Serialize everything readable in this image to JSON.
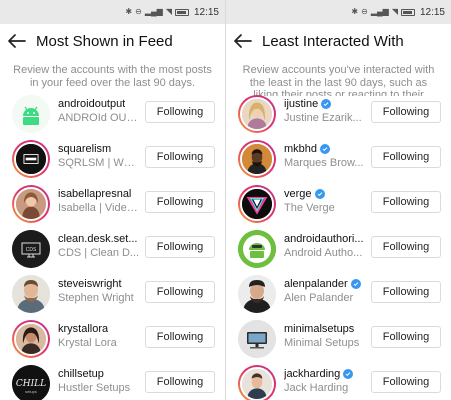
{
  "status_bar": {
    "time": "12:15"
  },
  "left": {
    "title": "Most Shown in Feed",
    "description": "Review the accounts with the most posts in your feed over the last 90 days.",
    "accounts": [
      {
        "username": "androidoutput",
        "fullname": "ANDROId OUT...",
        "verified": false,
        "button": "Following",
        "avatar": "android-logo-avatar"
      },
      {
        "username": "squarelism",
        "fullname": "SQRLSM | WO...",
        "verified": false,
        "button": "Following",
        "avatar": "squarelism-avatar"
      },
      {
        "username": "isabellapresnal",
        "fullname": "Isabella | Video...",
        "verified": false,
        "button": "Following",
        "avatar": "person-avatar"
      },
      {
        "username": "clean.desk.set...",
        "fullname": "CDS | Clean D...",
        "verified": false,
        "button": "Following",
        "avatar": "cds-avatar"
      },
      {
        "username": "steveiswright",
        "fullname": "Stephen Wright",
        "verified": false,
        "button": "Following",
        "avatar": "person-avatar"
      },
      {
        "username": "krystallora",
        "fullname": "Krystal Lora",
        "verified": false,
        "button": "Following",
        "avatar": "person-avatar"
      },
      {
        "username": "chillsetup",
        "fullname": "Hustler Setups",
        "verified": false,
        "button": "Following",
        "avatar": "chill-avatar"
      }
    ]
  },
  "right": {
    "title": "Least Interacted With",
    "description": "Review accounts you've interacted with the least in the last 90 days, such as liking their posts or reacting to their",
    "accounts": [
      {
        "username": "ijustine",
        "fullname": "Justine Ezarik...",
        "verified": true,
        "button": "Following",
        "avatar": "person-avatar"
      },
      {
        "username": "mkbhd",
        "fullname": "Marques Brow...",
        "verified": true,
        "button": "Following",
        "avatar": "person-avatar"
      },
      {
        "username": "verge",
        "fullname": "The Verge",
        "verified": true,
        "button": "Following",
        "avatar": "verge-logo-avatar"
      },
      {
        "username": "androidauthori...",
        "fullname": "Android Autho...",
        "verified": false,
        "button": "Following",
        "avatar": "android-authority-avatar"
      },
      {
        "username": "alenpalander",
        "fullname": "Alen Palander",
        "verified": true,
        "button": "Following",
        "avatar": "person-avatar"
      },
      {
        "username": "minimalsetups",
        "fullname": "Minimal Setups",
        "verified": false,
        "button": "Following",
        "avatar": "minimal-setups-avatar"
      },
      {
        "username": "jackharding",
        "fullname": "Jack Harding",
        "verified": true,
        "button": "Following",
        "avatar": "person-avatar"
      }
    ]
  },
  "colors": {
    "ring_start": "#f7a234",
    "ring_end": "#c13584",
    "verified_blue": "#3897f0",
    "muted_text": "#8e8e8e"
  }
}
